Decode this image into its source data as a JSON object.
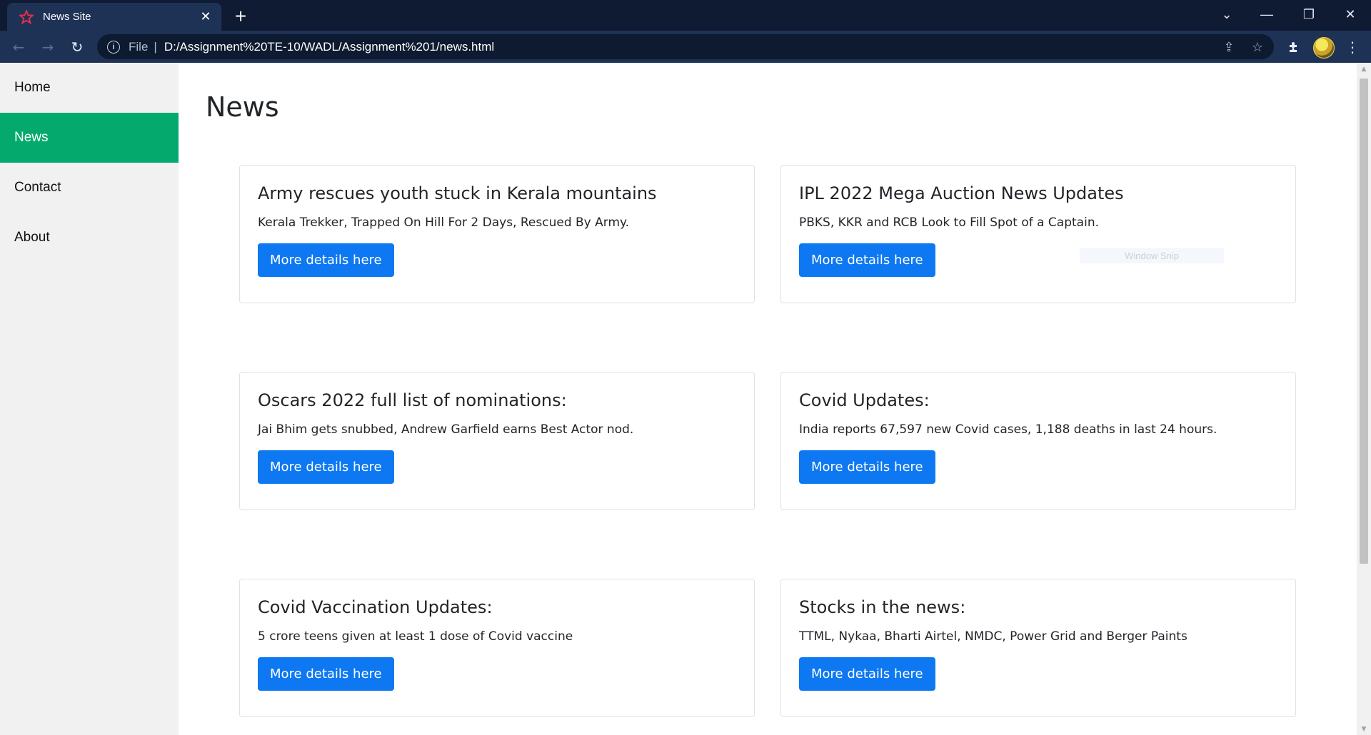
{
  "browser": {
    "tab_title": "News Site",
    "tab_close": "✕",
    "new_tab": "+",
    "window_controls": {
      "tabsearch": "⌄",
      "minimize": "—",
      "restore": "❐",
      "close": "✕"
    },
    "nav": {
      "back": "←",
      "forward": "→",
      "reload": "↻"
    },
    "omnibox": {
      "info": "i",
      "scheme_label": "File",
      "separator": "|",
      "url": "D:/Assignment%20TE-10/WADL/Assignment%201/news.html",
      "share": "⇪",
      "star": "☆"
    },
    "menu": "⋮",
    "extensions": "✱"
  },
  "sidebar": {
    "items": [
      {
        "label": "Home",
        "active": false
      },
      {
        "label": "News",
        "active": true
      },
      {
        "label": "Contact",
        "active": false
      },
      {
        "label": "About",
        "active": false
      }
    ],
    "active_color": "#04aa6d"
  },
  "main": {
    "title": "News",
    "cards": [
      {
        "title": "Army rescues youth stuck in Kerala mountains",
        "text": "Kerala Trekker, Trapped On Hill For 2 Days, Rescued By Army.",
        "button": "More details here"
      },
      {
        "title": "IPL 2022 Mega Auction News Updates",
        "text": "PBKS, KKR and RCB Look to Fill Spot of a Captain.",
        "button": "More details here"
      },
      {
        "title": "Oscars 2022 full list of nominations:",
        "text": "Jai Bhim gets snubbed, Andrew Garfield earns Best Actor nod.",
        "button": "More details here"
      },
      {
        "title": "Covid Updates:",
        "text": "India reports 67,597 new Covid cases, 1,188 deaths in last 24 hours.",
        "button": "More details here"
      },
      {
        "title": "Covid Vaccination Updates:",
        "text": "5 crore teens given at least 1 dose of Covid vaccine",
        "button": "More details here"
      },
      {
        "title": "Stocks in the news:",
        "text": "TTML, Nykaa, Bharti Airtel, NMDC, Power Grid and Berger Paints",
        "button": "More details here"
      }
    ],
    "button_color": "#0d78f2"
  },
  "overlay": {
    "snip_label": "Window Snip"
  },
  "scrollbar": {
    "up": "▲",
    "down": "▼"
  }
}
